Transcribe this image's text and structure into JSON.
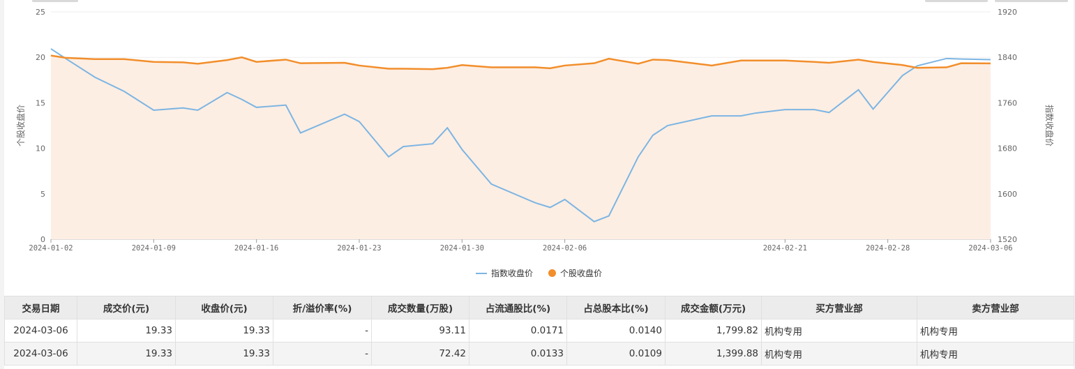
{
  "chart_data": {
    "type": "line",
    "x": [
      "2024-01-02",
      "2024-01-03",
      "2024-01-05",
      "2024-01-07",
      "2024-01-08",
      "2024-01-09",
      "2024-01-11",
      "2024-01-12",
      "2024-01-14",
      "2024-01-15",
      "2024-01-16",
      "2024-01-18",
      "2024-01-19",
      "2024-01-21",
      "2024-01-22",
      "2024-01-23",
      "2024-01-25",
      "2024-01-26",
      "2024-01-28",
      "2024-01-29",
      "2024-01-30",
      "2024-02-01",
      "2024-02-02",
      "2024-02-04",
      "2024-02-05",
      "2024-02-06",
      "2024-02-08",
      "2024-02-09",
      "2024-02-11",
      "2024-02-12",
      "2024-02-13",
      "2024-02-15",
      "2024-02-16",
      "2024-02-18",
      "2024-02-19",
      "2024-02-21",
      "2024-02-23",
      "2024-02-24",
      "2024-02-26",
      "2024-02-27",
      "2024-02-28",
      "2024-02-29",
      "2024-03-01",
      "2024-03-03",
      "2024-03-04",
      "2024-03-06"
    ],
    "x_ticks": [
      "2024-01-02",
      "2024-01-09",
      "2024-01-16",
      "2024-01-23",
      "2024-01-30",
      "2024-02-06",
      "2024-02-21",
      "2024-02-28",
      "2024-03-06"
    ],
    "series": [
      {
        "name": "指数收盘价",
        "axis": "right",
        "color": "#7cb5e3",
        "values": [
          1855,
          1838,
          1805,
          1780,
          1747,
          1751,
          1747,
          1778,
          1766,
          1752,
          1756,
          1707,
          1740,
          1727,
          1665,
          1683,
          1688,
          1716,
          1678,
          1617,
          1584,
          1576,
          1590,
          1551,
          1561,
          1665,
          1703,
          1720,
          1737,
          1737,
          1742,
          1748,
          1748,
          1743,
          1783,
          1749,
          1808,
          1825,
          1838,
          1837,
          1836
        ]
      },
      {
        "name": "个股收盘价",
        "axis": "left",
        "color": "#f28e2b",
        "values": [
          20.2,
          19.95,
          19.8,
          19.8,
          19.5,
          19.45,
          19.3,
          19.7,
          20.0,
          19.5,
          19.75,
          19.35,
          19.4,
          19.1,
          18.75,
          18.75,
          18.7,
          18.85,
          19.15,
          18.9,
          18.9,
          18.8,
          19.1,
          19.35,
          19.85,
          19.3,
          19.75,
          19.7,
          19.1,
          19.65,
          19.65,
          19.65,
          19.5,
          19.4,
          19.75,
          19.5,
          19.15,
          18.85,
          18.9,
          19.35,
          19.33
        ]
      }
    ],
    "ylabel_left": "个股收盘价",
    "ylabel_right": "指数收盘价",
    "ylim_left": [
      0,
      25
    ],
    "yticks_left": [
      "0",
      "5",
      "10",
      "15",
      "20",
      "25"
    ],
    "ylim_right": [
      1520,
      1920
    ],
    "yticks_right": [
      "1520",
      "1600",
      "1680",
      "1760",
      "1840",
      "1920"
    ],
    "area_fill": "#fdeee3",
    "legend_position": "bottom-center"
  },
  "legend": {
    "index_label": "指数收盘价",
    "stock_label": "个股收盘价"
  },
  "table": {
    "headers": [
      "交易日期",
      "成交价(元)",
      "收盘价(元)",
      "折/溢价率(%)",
      "成交数量(万股)",
      "占流通股比(%)",
      "占总股本比(%)",
      "成交金额(万元)",
      "买方营业部",
      "卖方营业部"
    ],
    "rows": [
      [
        "2024-03-06",
        "19.33",
        "19.33",
        "-",
        "93.11",
        "0.0171",
        "0.0140",
        "1,799.82",
        "机构专用",
        "机构专用"
      ],
      [
        "2024-03-06",
        "19.33",
        "19.33",
        "-",
        "72.42",
        "0.0133",
        "0.0109",
        "1,399.88",
        "机构专用",
        "机构专用"
      ]
    ]
  }
}
